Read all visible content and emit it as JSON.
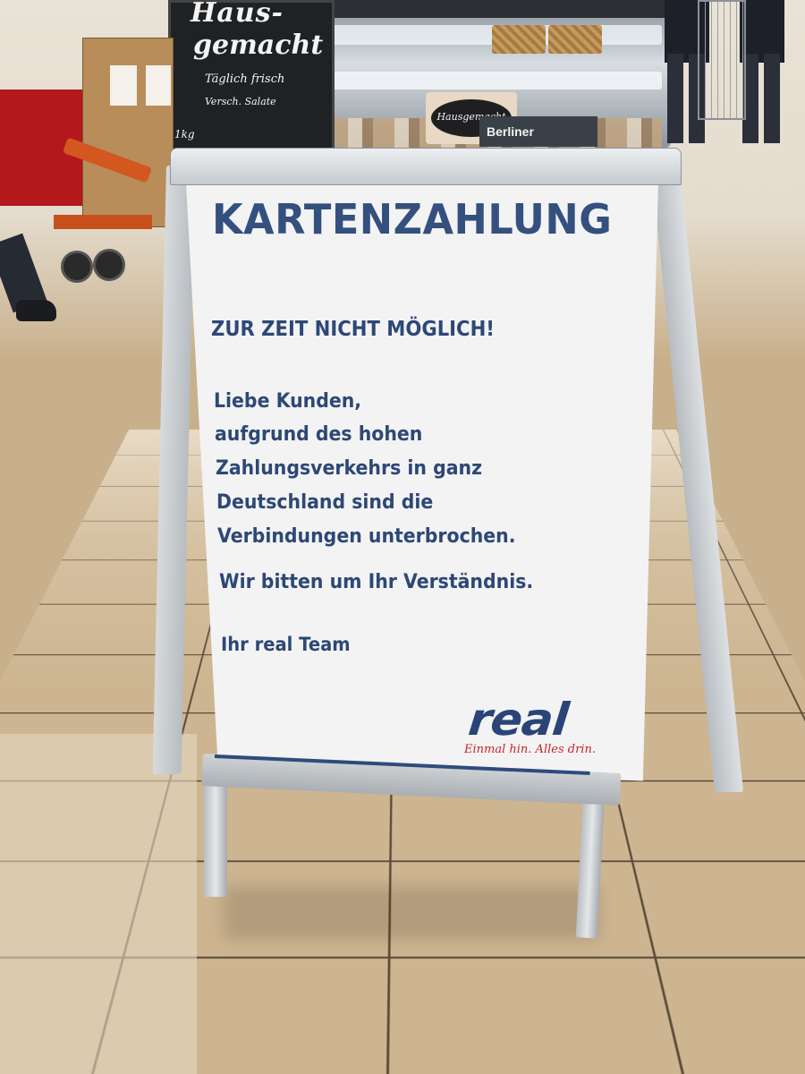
{
  "sign": {
    "headline": "KARTENZAHLUNG",
    "subheadline": "ZUR ZEIT NICHT MÖGLICH!",
    "body_lines": [
      "Liebe Kunden,",
      "aufgrund des hohen",
      "Zahlungsverkehrs in ganz",
      "Deutschland sind die",
      "Verbindungen unterbrochen."
    ],
    "thanks": "Wir bitten um Ihr Verständnis.",
    "signoff": "Ihr real Team",
    "brand": {
      "logo": "real",
      "slogan": "Einmal hin. Alles drin.",
      "logo_color": "#2a4478",
      "slogan_color": "#c8242b"
    },
    "text_color": "#2d4875"
  },
  "background": {
    "chalkboard": {
      "line1": "Haus-",
      "line2": "gemacht",
      "line3": "Täglich frisch",
      "line4": "Versch. Salate",
      "line5": "1kg"
    },
    "counter_labels": {
      "hausgemacht": "Hausgemacht",
      "berliner": "Berliner"
    }
  }
}
